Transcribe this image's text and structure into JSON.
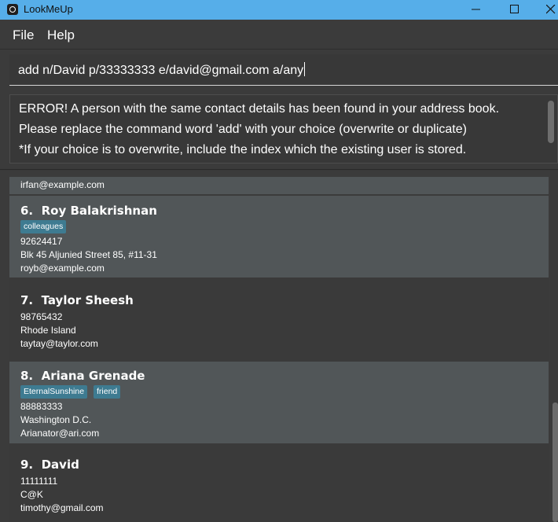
{
  "window": {
    "title": "LookMeUp"
  },
  "menu": {
    "file": "File",
    "help": "Help"
  },
  "command": {
    "value": "add n/David p/33333333 e/david@gmail.com a/any"
  },
  "result": {
    "lines": [
      "ERROR! A person with the same contact details has been found in your address book.",
      "Please replace the command word 'add' with your choice (overwrite or duplicate)",
      "*If your choice is to overwrite, include the index which the existing user is stored."
    ]
  },
  "persons": [
    {
      "email": "irfan@example.com"
    },
    {
      "index": "6.",
      "name": "Roy Balakrishnan",
      "tags": [
        "colleagues"
      ],
      "phone": "92624417",
      "address": "Blk 45 Aljunied Street 85, #11-31",
      "email": "royb@example.com"
    },
    {
      "index": "7.",
      "name": "Taylor Sheesh",
      "phone": "98765432",
      "address": "Rhode Island",
      "email": "taytay@taylor.com"
    },
    {
      "index": "8.",
      "name": "Ariana Grenade",
      "tags": [
        "EternalSunshine",
        "friend"
      ],
      "phone": "88883333",
      "address": "Washington D.C.",
      "email": "Arianator@ari.com"
    },
    {
      "index": "9.",
      "name": "David",
      "phone": "11111111",
      "address": "C@K",
      "email": "timothy@gmail.com"
    }
  ],
  "colors": {
    "titlebar": "#56aee9",
    "background": "#383838",
    "card_light": "#515658",
    "tag": "#3e7b91"
  }
}
